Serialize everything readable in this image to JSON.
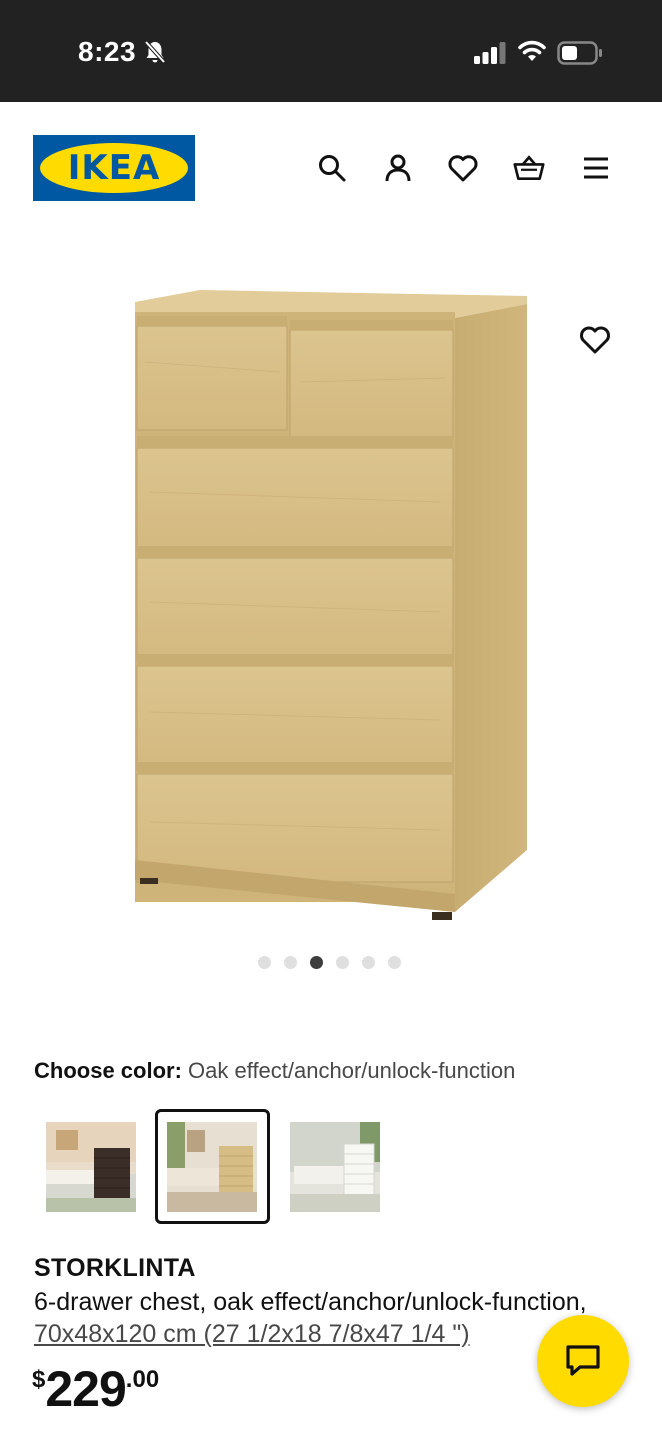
{
  "status_bar": {
    "time": "8:23"
  },
  "header": {
    "logo_text": "IKEA",
    "icons": [
      "search-icon",
      "account-icon",
      "heart-icon",
      "basket-icon",
      "menu-icon"
    ]
  },
  "gallery": {
    "image_count": 6,
    "active_index": 2
  },
  "color_chooser": {
    "label": "Choose color:",
    "value": "Oak effect/anchor/unlock-function",
    "swatches": [
      "black-brown",
      "oak effect",
      "white"
    ],
    "selected_index": 1
  },
  "product": {
    "name": "STORKLINTA",
    "description": "6-drawer chest, oak effect/anchor/unlock-function,",
    "measurements": "70x48x120 cm (27 1/2x18 7/8x47 1/4 \")",
    "price": {
      "currency": "$",
      "integer": "229",
      "decimal": ".00"
    }
  },
  "colors": {
    "ikea_blue": "#0058a3",
    "ikea_yellow": "#ffdb00",
    "wood": "#d9c089"
  }
}
